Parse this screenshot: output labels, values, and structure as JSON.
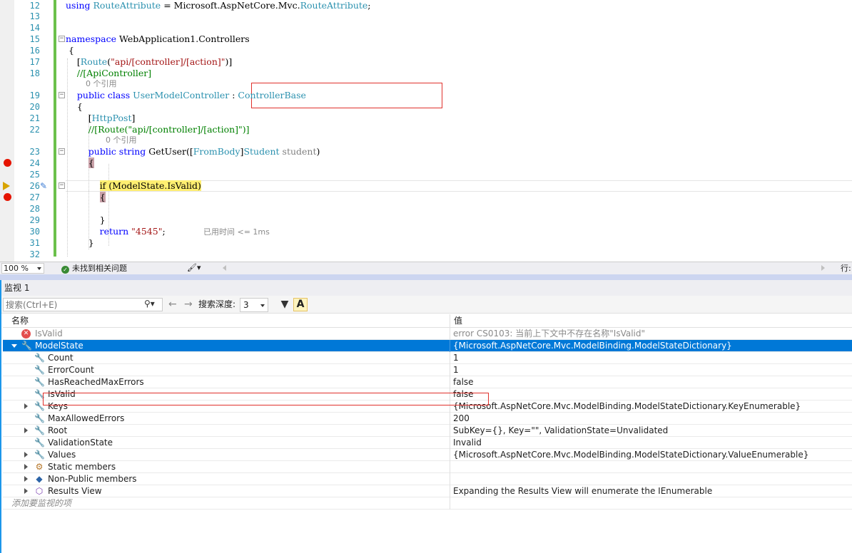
{
  "editor": {
    "zoom": "100 %",
    "status": "未找到相关问题",
    "row_label": "行:",
    "lines": [
      {
        "no": "12",
        "segments": [
          {
            "t": "using ",
            "c": "kw"
          },
          {
            "t": "RouteAttribute",
            "c": "ty"
          },
          {
            "t": " = Microsoft.AspNetCore.Mvc.",
            "c": ""
          },
          {
            "t": "RouteAttribute",
            "c": "ty"
          },
          {
            "t": ";",
            "c": ""
          }
        ]
      },
      {
        "no": "13",
        "segments": []
      },
      {
        "no": "14",
        "segments": []
      },
      {
        "no": "15",
        "segments": [
          {
            "t": "namespace ",
            "c": "kw"
          },
          {
            "t": "WebApplication1.Controllers",
            "c": ""
          }
        ]
      },
      {
        "no": "16",
        "segments": [
          {
            "t": " {",
            "c": ""
          }
        ]
      },
      {
        "no": "17",
        "segments": [
          {
            "t": "    [",
            "c": ""
          },
          {
            "t": "Route",
            "c": "ty"
          },
          {
            "t": "(",
            "c": ""
          },
          {
            "t": "\"api/[controller]/[action]\"",
            "c": "st"
          },
          {
            "t": ")]",
            "c": ""
          }
        ]
      },
      {
        "no": "18",
        "segments": [
          {
            "t": "    //[ApiController]",
            "c": "cm"
          }
        ]
      },
      {
        "no": "19",
        "segments": [
          {
            "t": "    public class ",
            "c": "kw"
          },
          {
            "t": "UserModelController",
            "c": "ty"
          },
          {
            "t": " : ",
            "c": ""
          },
          {
            "t": "ControllerBase",
            "c": "ty"
          }
        ]
      },
      {
        "no": "20",
        "segments": [
          {
            "t": "    {",
            "c": ""
          }
        ]
      },
      {
        "no": "21",
        "segments": [
          {
            "t": "        [",
            "c": ""
          },
          {
            "t": "HttpPost",
            "c": "ty"
          },
          {
            "t": "]",
            "c": ""
          }
        ]
      },
      {
        "no": "22",
        "segments": [
          {
            "t": "        //[Route(\"api/[controller]/[action]\")]",
            "c": "cm"
          }
        ]
      },
      {
        "no": "23",
        "segments": [
          {
            "t": "        public string ",
            "c": "kw"
          },
          {
            "t": "GetUser([",
            "c": ""
          },
          {
            "t": "FromBody",
            "c": "ty"
          },
          {
            "t": "]",
            "c": ""
          },
          {
            "t": "Student",
            "c": "ty"
          },
          {
            "t": " ",
            "c": ""
          },
          {
            "t": "student",
            "c": "gr"
          },
          {
            "t": ")",
            "c": ""
          }
        ]
      },
      {
        "no": "24",
        "segments": [
          {
            "t": "        ",
            "c": ""
          },
          {
            "t": "{",
            "c": "brace-hl"
          }
        ]
      },
      {
        "no": "25",
        "segments": []
      },
      {
        "no": "26",
        "segments": [
          {
            "t": "            ",
            "c": ""
          },
          {
            "t": "if (ModelState.IsValid)",
            "c": "yl"
          }
        ]
      },
      {
        "no": "27",
        "segments": [
          {
            "t": "            ",
            "c": ""
          },
          {
            "t": "{",
            "c": "brace-hl"
          }
        ]
      },
      {
        "no": "28",
        "segments": []
      },
      {
        "no": "29",
        "segments": [
          {
            "t": "            }",
            "c": ""
          }
        ]
      },
      {
        "no": "30",
        "segments": [
          {
            "t": "            return ",
            "c": "kw"
          },
          {
            "t": "\"4545\"",
            "c": "st"
          },
          {
            "t": ";",
            "c": ""
          }
        ]
      },
      {
        "no": "31",
        "segments": [
          {
            "t": "        }",
            "c": ""
          }
        ]
      },
      {
        "no": "32",
        "segments": []
      }
    ],
    "codelens_1": "0 个引用",
    "codelens_2": "0 个引用",
    "elapsed": "已用时间 <= 1ms"
  },
  "watch": {
    "title": "监视 1",
    "search_placeholder": "搜索(Ctrl+E)",
    "depth_label": "搜索深度:",
    "depth_value": "3",
    "font_button": "A",
    "col_name": "名称",
    "col_value": "值",
    "add_placeholder": "添加要监视的项",
    "rows": [
      {
        "name": "IsValid",
        "value": "error CS0103: 当前上下文中不存在名称\"IsValid\"",
        "icon": "error-icon",
        "level": 0,
        "expander": "none",
        "state": "error"
      },
      {
        "name": "ModelState",
        "value": "{Microsoft.AspNetCore.Mvc.ModelBinding.ModelStateDictionary}",
        "icon": "wrench-icon",
        "level": 0,
        "expander": "open",
        "state": "selected"
      },
      {
        "name": "Count",
        "value": "1",
        "icon": "wrench-icon",
        "level": 1,
        "expander": "none",
        "state": ""
      },
      {
        "name": "ErrorCount",
        "value": "1",
        "icon": "wrench-icon",
        "level": 1,
        "expander": "none",
        "state": ""
      },
      {
        "name": "HasReachedMaxErrors",
        "value": "false",
        "icon": "wrench-icon",
        "level": 1,
        "expander": "none",
        "state": ""
      },
      {
        "name": "IsValid",
        "value": "false",
        "icon": "wrench-icon",
        "level": 1,
        "expander": "none",
        "state": "boxed"
      },
      {
        "name": "Keys",
        "value": "{Microsoft.AspNetCore.Mvc.ModelBinding.ModelStateDictionary.KeyEnumerable}",
        "icon": "wrench-icon",
        "level": 1,
        "expander": "collapsed",
        "state": ""
      },
      {
        "name": "MaxAllowedErrors",
        "value": "200",
        "icon": "wrench-icon",
        "level": 1,
        "expander": "none",
        "state": ""
      },
      {
        "name": "Root",
        "value": "SubKey={}, Key=\"\", ValidationState=Unvalidated",
        "icon": "wrench-icon",
        "level": 1,
        "expander": "collapsed",
        "state": ""
      },
      {
        "name": "ValidationState",
        "value": "Invalid",
        "icon": "wrench-icon",
        "level": 1,
        "expander": "none",
        "state": ""
      },
      {
        "name": "Values",
        "value": "{Microsoft.AspNetCore.Mvc.ModelBinding.ModelStateDictionary.ValueEnumerable}",
        "icon": "wrench-icon",
        "level": 1,
        "expander": "collapsed",
        "state": ""
      },
      {
        "name": "Static members",
        "value": "",
        "icon": "static-members-icon",
        "level": 1,
        "expander": "collapsed",
        "state": ""
      },
      {
        "name": "Non-Public members",
        "value": "",
        "icon": "non-public-members-icon",
        "level": 1,
        "expander": "collapsed",
        "state": ""
      },
      {
        "name": "Results View",
        "value": "Expanding the Results View will enumerate the IEnumerable",
        "icon": "results-view-icon",
        "level": 1,
        "expander": "collapsed",
        "state": ""
      }
    ]
  }
}
